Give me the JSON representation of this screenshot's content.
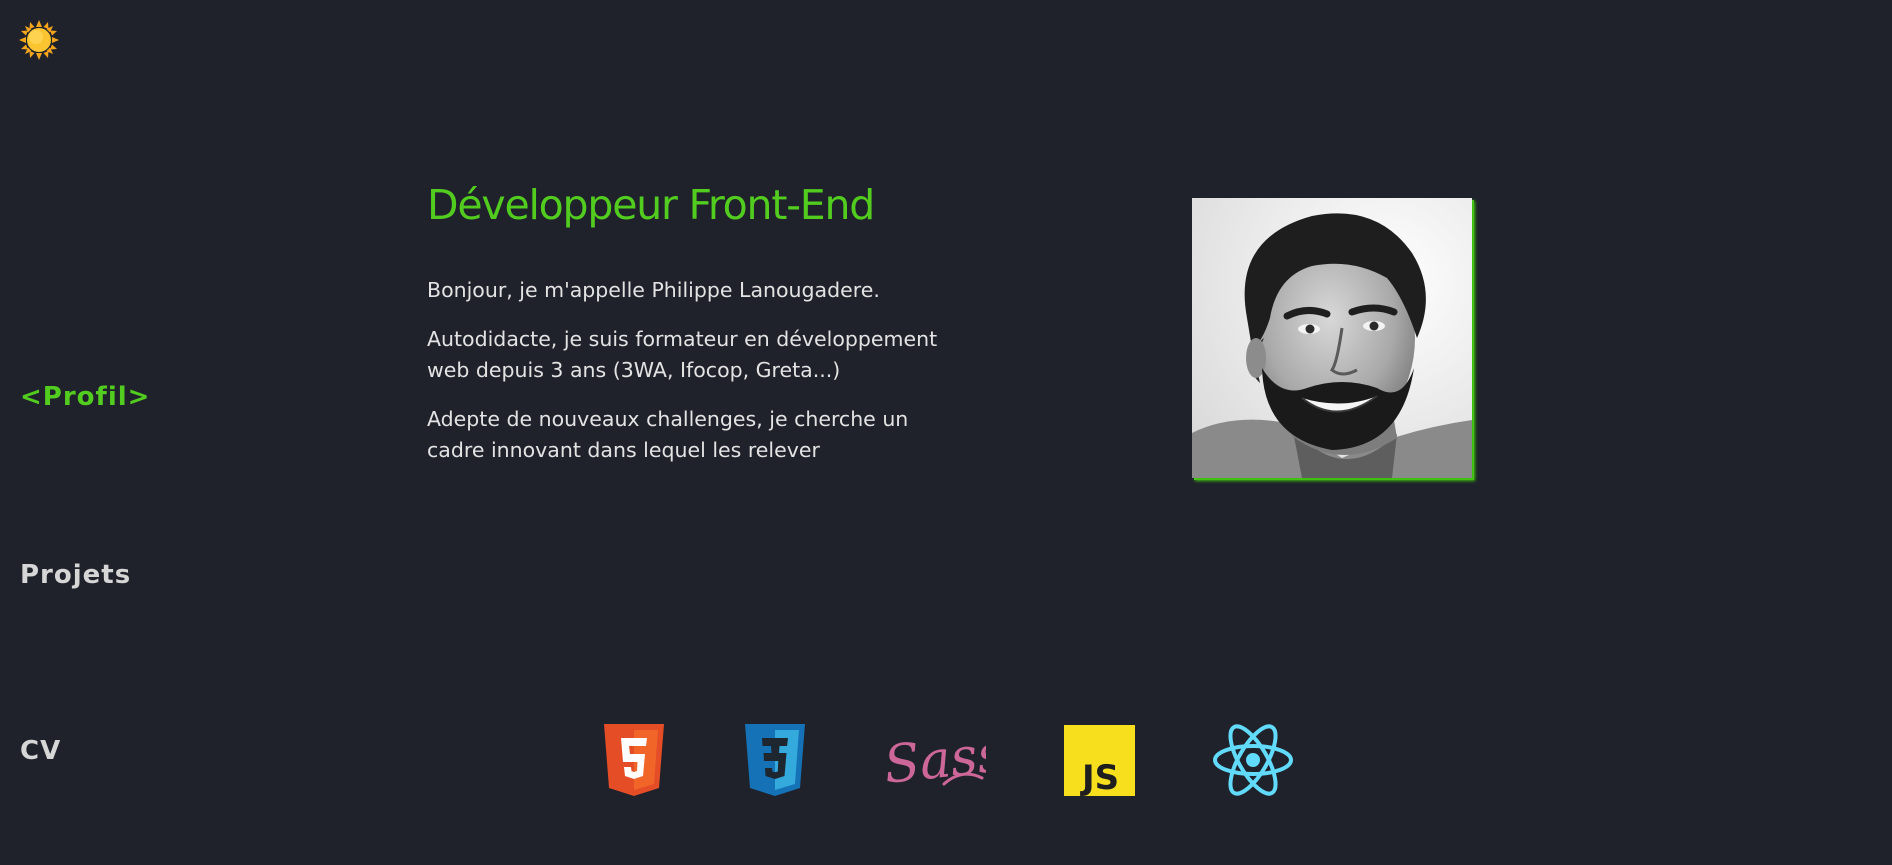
{
  "theme_toggle": {
    "icon": "sun-icon"
  },
  "nav": {
    "items": [
      {
        "label": "<Profil>",
        "active": true
      },
      {
        "label": "Projets",
        "active": false
      },
      {
        "label": "CV",
        "active": false
      }
    ]
  },
  "profile": {
    "headline": "Développeur Front-End",
    "paragraphs": [
      "Bonjour, je m'appelle Philippe Lanougadere.",
      "Autodidacte, je suis formateur en développement web depuis 3 ans (3WA, Ifocop, Greta...)",
      "Adepte de nouveaux challenges, je cherche un cadre innovant dans lequel les relever"
    ],
    "photo": {
      "icon": "profile-photo"
    }
  },
  "technologies": [
    {
      "icon": "html5-icon",
      "color": "#e44d26"
    },
    {
      "icon": "css3-icon",
      "color": "#2a9fd8"
    },
    {
      "icon": "sass-icon",
      "label": "Sass",
      "color": "#cd6799"
    },
    {
      "icon": "javascript-icon",
      "label": "JS",
      "color": "#f7df1e"
    },
    {
      "icon": "react-icon",
      "color": "#61dafb"
    }
  ],
  "colors": {
    "background": "#1f222b",
    "accent": "#52cc1f",
    "text": "#e3e3e3",
    "nav_text": "#d6d6d6"
  }
}
